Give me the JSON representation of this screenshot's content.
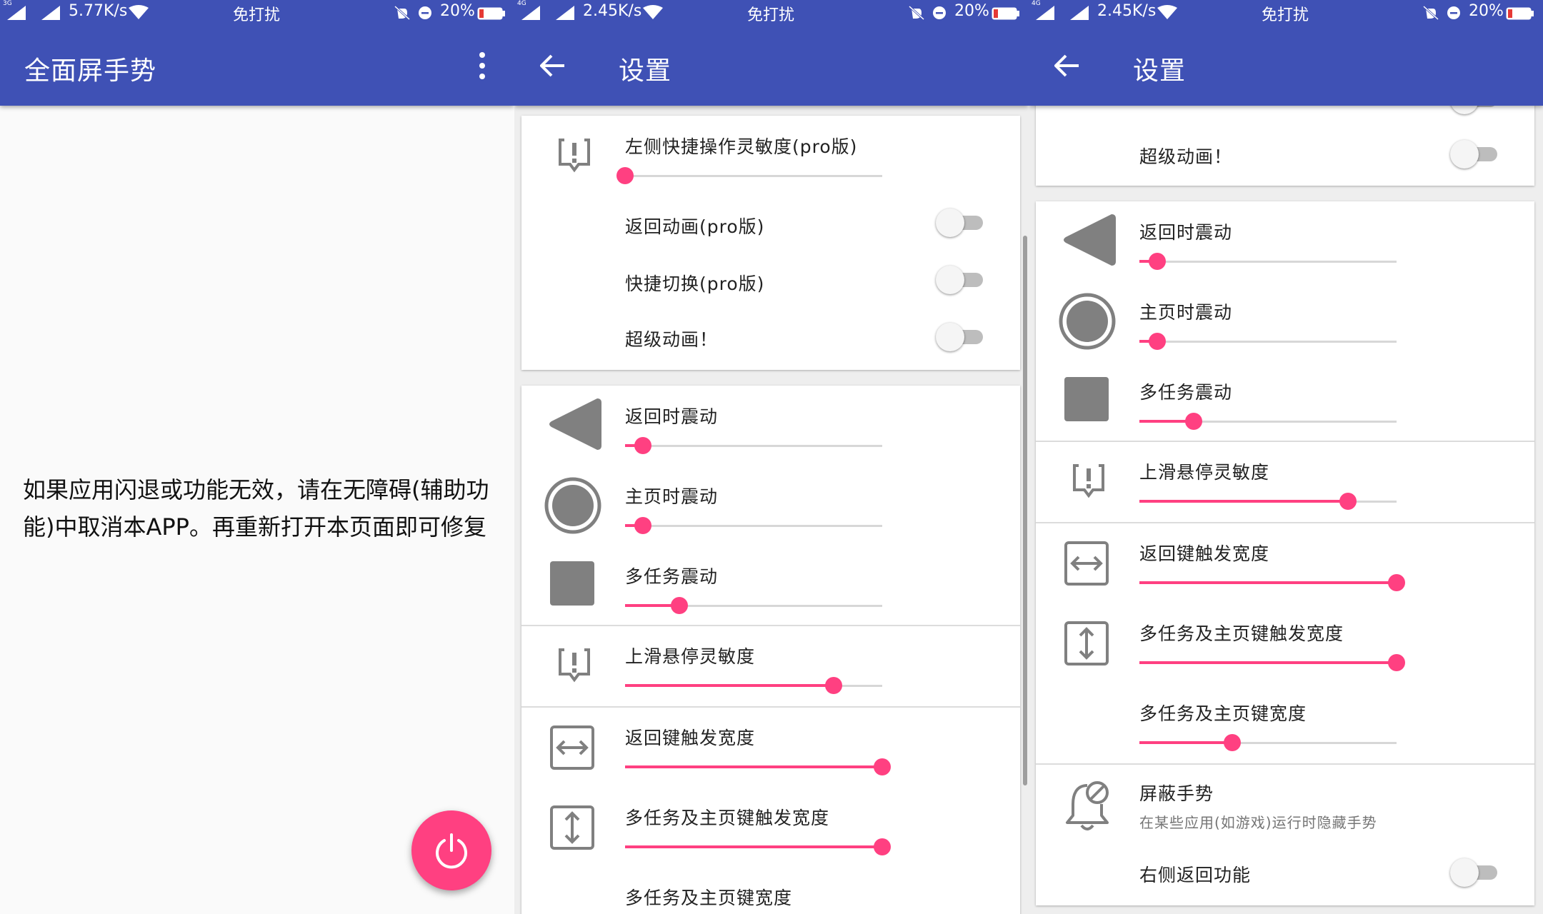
{
  "colors": {
    "primary": "#3f51b5",
    "accent": "#ff4081",
    "icon": "#808080"
  },
  "screens": [
    {
      "status": {
        "net": "3G",
        "speed": "5.77K/s",
        "dnd": "免打扰",
        "battery": "20%"
      },
      "title": "全面屏手势",
      "message": "如果应用闪退或功能无效，请在无障碍(辅助功能)中取消本APP。再重新打开本页面即可修复",
      "fab_icon": "power-icon",
      "menu_icon": "more-vert-icon"
    },
    {
      "status": {
        "net": "4G",
        "speed": "2.45K/s",
        "dnd": "免打扰",
        "battery": "20%"
      },
      "title": "设置",
      "items": {
        "left_sensitivity": {
          "label": "左侧快捷操作灵敏度(pro版)",
          "value": 0
        },
        "back_anim": {
          "label": "返回动画(pro版)",
          "on": false
        },
        "quick_switch": {
          "label": "快捷切换(pro版)",
          "on": false
        },
        "super_anim": {
          "label": "超级动画！",
          "on": false
        },
        "back_vibrate": {
          "label": "返回时震动",
          "value": 0.07
        },
        "home_vibrate": {
          "label": "主页时震动",
          "value": 0.07
        },
        "recent_vibrate": {
          "label": "多任务震动",
          "value": 0.21
        },
        "swipe_hover": {
          "label": "上滑悬停灵敏度",
          "value": 0.81
        },
        "back_width": {
          "label": "返回键触发宽度",
          "value": 1.0
        },
        "recent_home_trigger": {
          "label": "多任务及主页键触发宽度",
          "value": 1.0
        },
        "recent_home_width": {
          "label": "多任务及主页键宽度"
        }
      }
    },
    {
      "status": {
        "net": "4G",
        "speed": "2.45K/s",
        "dnd": "免打扰",
        "battery": "20%"
      },
      "title": "设置",
      "items": {
        "super_anim": {
          "label": "超级动画！",
          "on": false
        },
        "back_vibrate": {
          "label": "返回时震动",
          "value": 0.07
        },
        "home_vibrate": {
          "label": "主页时震动",
          "value": 0.07
        },
        "recent_vibrate": {
          "label": "多任务震动",
          "value": 0.21
        },
        "swipe_hover": {
          "label": "上滑悬停灵敏度",
          "value": 0.81
        },
        "back_width": {
          "label": "返回键触发宽度",
          "value": 1.0
        },
        "recent_home_trigger": {
          "label": "多任务及主页键触发宽度",
          "value": 1.0
        },
        "recent_home_width": {
          "label": "多任务及主页键宽度",
          "value": 0.36
        },
        "block_gesture": {
          "label": "屏蔽手势",
          "sub": "在某些应用(如游戏)运行时隐藏手势"
        },
        "right_back": {
          "label": "右侧返回功能",
          "on": false
        }
      }
    }
  ]
}
